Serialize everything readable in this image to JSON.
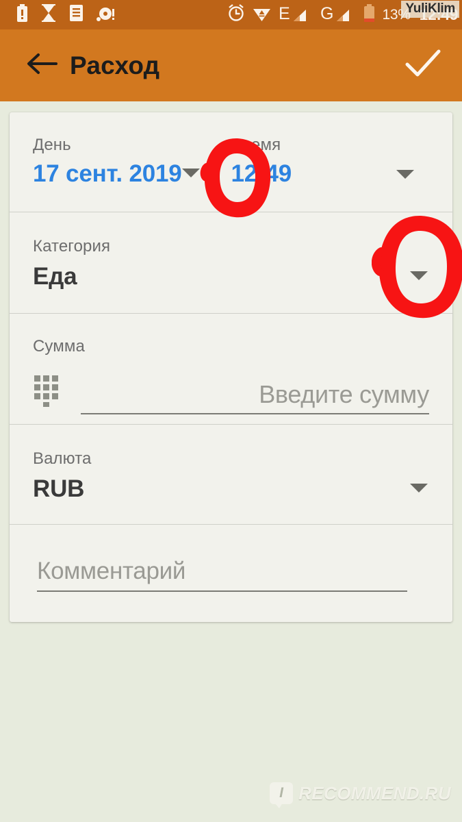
{
  "status_bar": {
    "icons_left": [
      "battery-alert-icon",
      "hourglass-icon",
      "document-icon",
      "alarm-disc-icon"
    ],
    "icons_right": [
      "alarm-clock-icon",
      "wifi-icon",
      "edge-signal-icon",
      "gprs-signal-icon",
      "battery-icon"
    ],
    "battery_percent": "13%",
    "clock": "12:49",
    "watermark": "YuliKlim",
    "background_color": "#bc6317"
  },
  "app_bar": {
    "back_icon": "arrow-left-icon",
    "title": "Расход",
    "confirm_icon": "check-icon",
    "background_color": "#d2781f"
  },
  "form": {
    "day": {
      "label": "День",
      "value": "17 сент. 2019",
      "caret_icon": "chevron-down-icon",
      "value_color": "#2d83e0"
    },
    "time": {
      "label": "Время",
      "value": "12:49",
      "caret_icon": "chevron-down-icon",
      "value_color": "#2d83e0"
    },
    "category": {
      "label": "Категория",
      "value": "Еда",
      "caret_icon": "chevron-down-icon"
    },
    "amount": {
      "label": "Сумма",
      "keypad_icon": "dialpad-icon",
      "value": "",
      "placeholder": "Введите сумму"
    },
    "currency": {
      "label": "Валюта",
      "value": "RUB",
      "caret_icon": "chevron-down-icon"
    },
    "comment": {
      "value": "",
      "placeholder": "Комментарий"
    }
  },
  "annotations": {
    "color": "#f71414",
    "marks": [
      {
        "name": "circle-around-date-caret",
        "shape": "hand-drawn-ellipse"
      },
      {
        "name": "circle-around-category-caret",
        "shape": "hand-drawn-ellipse"
      }
    ]
  },
  "watermark_bottom": {
    "badge_letter": "I",
    "text": "RECOMMEND.RU"
  }
}
